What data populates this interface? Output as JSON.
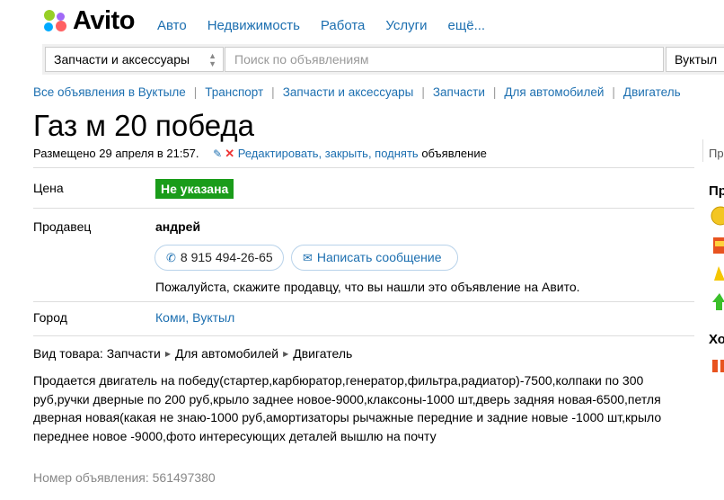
{
  "header": {
    "logo_text": "Avito",
    "nav": [
      "Авто",
      "Недвижимость",
      "Работа",
      "Услуги",
      "ещё..."
    ]
  },
  "search": {
    "category": "Запчасти и аксессуары",
    "placeholder": "Поиск по объявлениям",
    "region": "Вуктыл"
  },
  "breadcrumbs": [
    "Все объявления в Вуктыле",
    "Транспорт",
    "Запчасти и аксессуары",
    "Запчасти",
    "Для автомобилей",
    "Двигатель"
  ],
  "ad": {
    "title": "Газ м 20 победа",
    "posted": "Размещено 29 апреля в 21:57.",
    "edit_link": "Редактировать, закрыть, поднять",
    "edit_suffix": " объявление",
    "price_label": "Цена",
    "price_value": "Не указана",
    "seller_label": "Продавец",
    "seller_name": "андрей",
    "phone": "8 915 494-26-65",
    "message_button": "Написать сообщение",
    "notice": "Пожалуйста, скажите продавцу, что вы нашли это объявление на Авито.",
    "city_label": "Город",
    "city_value": "Коми, Вуктыл",
    "kind_label": "Вид товара:",
    "kind_path": [
      "Запчасти",
      "Для автомобилей",
      "Двигатель"
    ],
    "description": "Продается двигатель на победу(стартер,карбюратор,генератор,фильтра,радиатор)-7500,колпаки по 300 руб,ручки дверные по 200 руб,крыло заднее новое-9000,клаксоны-1000 шт,дверь задняя новая-6500,петля дверная новая(какая не знаю-1000 руб,амортизаторы рычажные передние и задние новые -1000 шт,крыло переднее новое -9000,фото интересующих деталей вышлю на почту",
    "ad_number": "Номер объявления: 561497380"
  },
  "sidebar": {
    "text_partial": "Про",
    "head1_partial": "Пр",
    "head2_partial": "Хо"
  },
  "colors": {
    "link": "#1c6fb0",
    "price_badge": "#1a9c1a"
  }
}
